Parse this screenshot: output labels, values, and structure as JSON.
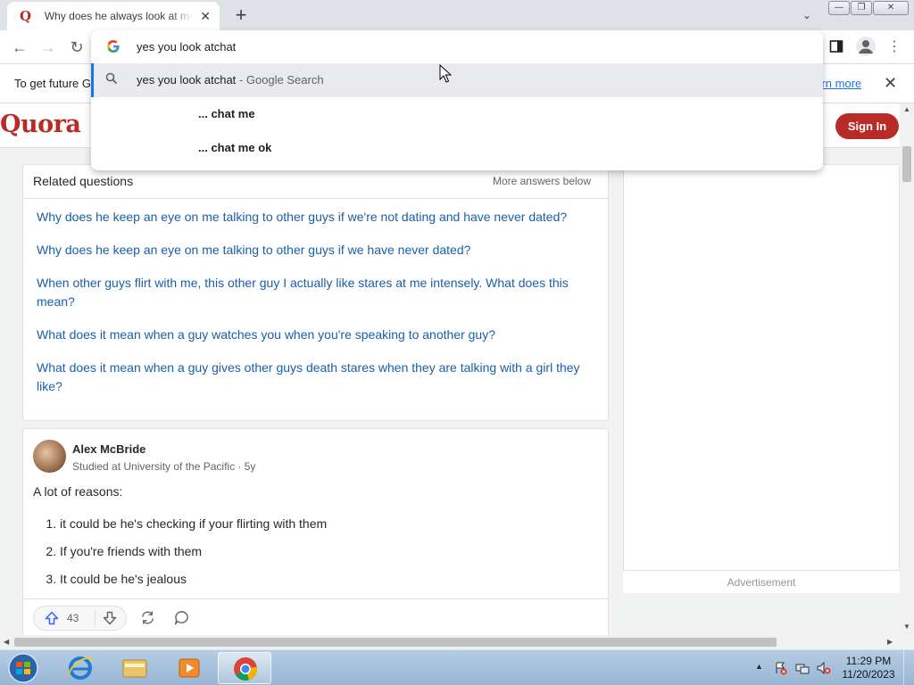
{
  "browser": {
    "tab": {
      "title": "Why does he always look at me when I talk to other guys? - Quora",
      "close": "✕"
    },
    "new_tab": "+",
    "tab_search": "⌄",
    "window_controls": {
      "minimize": "—",
      "maximize": "❐",
      "close": "✕"
    },
    "nav": {
      "back": "←",
      "forward": "→",
      "reload": "↻"
    },
    "menu": "⋮"
  },
  "omnibox": {
    "input_value": "yes you look atchat",
    "suggestions": [
      {
        "text": "yes you look atchat",
        "hint": " - Google Search"
      },
      {
        "text": "... chat me"
      },
      {
        "text": "... chat me ok"
      }
    ]
  },
  "infobar": {
    "text": "To get future G",
    "link": "earn more",
    "close": "✕"
  },
  "quora": {
    "logo": "Quora",
    "sign_in": "Sign In",
    "related": {
      "title": "Related questions",
      "more": "More answers below",
      "questions": [
        "Why does he keep an eye on me talking to other guys if we're not dating and have never dated?",
        "Why does he keep an eye on me talking to other guys if we have never dated?",
        "When other guys flirt with me, this other guy I actually like stares at me intensely. What does this mean?",
        "What does it mean when a guy watches you when you're speaking to another guy?",
        "What does it mean when a guy gives other guys death stares when they are talking with a girl they like?"
      ]
    },
    "answer": {
      "author": "Alex McBride",
      "credential": "Studied at University of the Pacific · 5y",
      "intro": "A lot of reasons:",
      "points": [
        "it could be he's checking if your flirting with them",
        "If you're friends with them",
        "It could be he's jealous"
      ],
      "upvotes": "43"
    },
    "ad_label": "Advertisement"
  },
  "taskbar": {
    "clock_time": "11:29 PM",
    "clock_date": "11/20/2023",
    "tray_arrow": "▲"
  },
  "colors": {
    "quora_red": "#b92b27",
    "link_blue": "#195faa",
    "chrome_blue": "#1a73e8"
  }
}
